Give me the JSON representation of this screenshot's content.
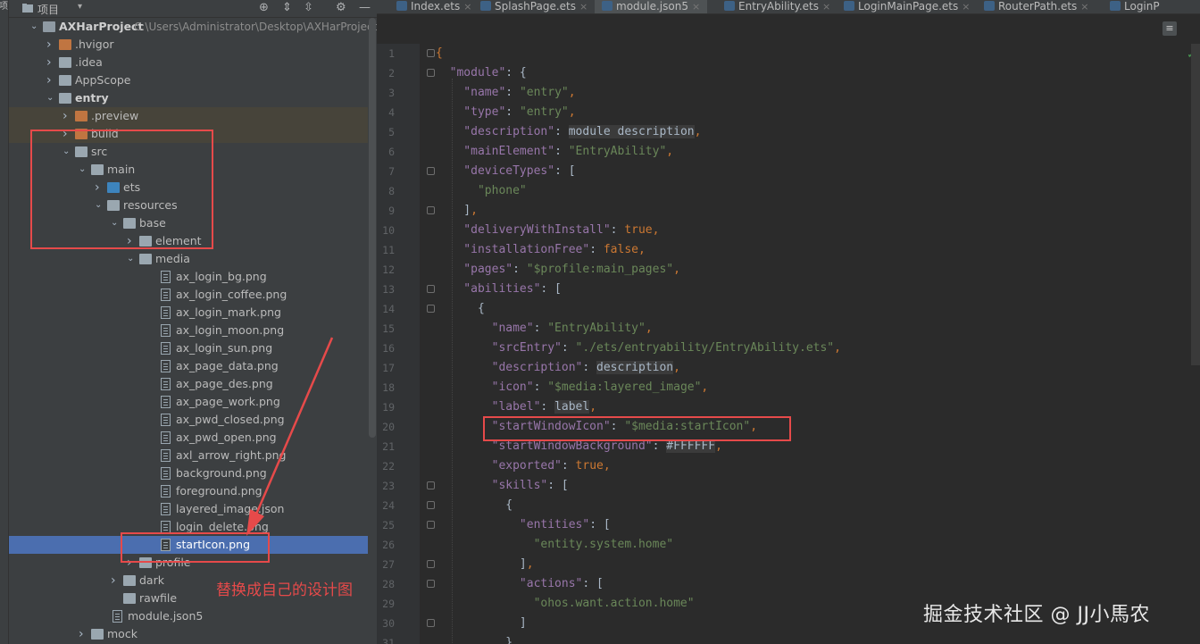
{
  "left_strip": {
    "label": "项"
  },
  "project_panel": {
    "title": "项目",
    "dropdown_glyph": "▾",
    "header_icons": [
      "crosshair-icon",
      "collapse-all-icon",
      "expand-all-icon",
      "settings-icon",
      "minimize-icon"
    ],
    "tree": [
      {
        "label": "AXHarProject",
        "path": "C:\\Users\\Administrator\\Desktop\\AXHarProject",
        "depth": 0,
        "kind": "root",
        "chevron": "open",
        "bold": true
      },
      {
        "label": ".hvigor",
        "depth": 1,
        "kind": "folder-orange",
        "chevron": "closed"
      },
      {
        "label": ".idea",
        "depth": 1,
        "kind": "folder-gray",
        "chevron": "closed"
      },
      {
        "label": "AppScope",
        "depth": 1,
        "kind": "folder-gray",
        "chevron": "closed"
      },
      {
        "label": "entry",
        "depth": 1,
        "kind": "folder-gray",
        "chevron": "open",
        "bold": true
      },
      {
        "label": ".preview",
        "depth": 2,
        "kind": "folder-orange",
        "chevron": "closed",
        "highlight": true
      },
      {
        "label": "build",
        "depth": 2,
        "kind": "folder-orange",
        "chevron": "closed",
        "highlight": true
      },
      {
        "label": "src",
        "depth": 2,
        "kind": "folder-gray",
        "chevron": "open"
      },
      {
        "label": "main",
        "depth": 3,
        "kind": "folder-gray",
        "chevron": "open"
      },
      {
        "label": "ets",
        "depth": 4,
        "kind": "folder-blue",
        "chevron": "closed"
      },
      {
        "label": "resources",
        "depth": 4,
        "kind": "folder-gray",
        "chevron": "open"
      },
      {
        "label": "base",
        "depth": 5,
        "kind": "folder-gray",
        "chevron": "open"
      },
      {
        "label": "element",
        "depth": 6,
        "kind": "folder-gray",
        "chevron": "closed"
      },
      {
        "label": "media",
        "depth": 6,
        "kind": "folder-gray",
        "chevron": "open"
      },
      {
        "label": "ax_login_bg.png",
        "depth": 7,
        "kind": "file"
      },
      {
        "label": "ax_login_coffee.png",
        "depth": 7,
        "kind": "file"
      },
      {
        "label": "ax_login_mark.png",
        "depth": 7,
        "kind": "file"
      },
      {
        "label": "ax_login_moon.png",
        "depth": 7,
        "kind": "file"
      },
      {
        "label": "ax_login_sun.png",
        "depth": 7,
        "kind": "file"
      },
      {
        "label": "ax_page_data.png",
        "depth": 7,
        "kind": "file"
      },
      {
        "label": "ax_page_des.png",
        "depth": 7,
        "kind": "file"
      },
      {
        "label": "ax_page_work.png",
        "depth": 7,
        "kind": "file"
      },
      {
        "label": "ax_pwd_closed.png",
        "depth": 7,
        "kind": "file"
      },
      {
        "label": "ax_pwd_open.png",
        "depth": 7,
        "kind": "file"
      },
      {
        "label": "axl_arrow_right.png",
        "depth": 7,
        "kind": "file"
      },
      {
        "label": "background.png",
        "depth": 7,
        "kind": "file"
      },
      {
        "label": "foreground.png",
        "depth": 7,
        "kind": "file"
      },
      {
        "label": "layered_image.json",
        "depth": 7,
        "kind": "file"
      },
      {
        "label": "login_delete.png",
        "depth": 7,
        "kind": "file"
      },
      {
        "label": "startIcon.png",
        "depth": 7,
        "kind": "file",
        "selected": true
      },
      {
        "label": "profile",
        "depth": 6,
        "kind": "folder-gray",
        "chevron": "closed"
      },
      {
        "label": "dark",
        "depth": 5,
        "kind": "folder-gray",
        "chevron": "closed"
      },
      {
        "label": "rawfile",
        "depth": 5,
        "kind": "folder-gray",
        "chevron": "none"
      },
      {
        "label": "module.json5",
        "depth": 4,
        "kind": "file"
      },
      {
        "label": "mock",
        "depth": 3,
        "kind": "folder-gray",
        "chevron": "closed"
      }
    ]
  },
  "editor": {
    "tabs": [
      {
        "label": "Index.ets",
        "active": false
      },
      {
        "label": "SplashPage.ets",
        "active": false
      },
      {
        "label": "module.json5",
        "active": true
      },
      {
        "label": "EntryAbility.ets",
        "active": false
      },
      {
        "label": "LoginMainPage.ets",
        "active": false
      },
      {
        "label": "RouterPath.ets",
        "active": false
      },
      {
        "label": "LoginP",
        "active": false
      }
    ],
    "tab_close_glyph": "×",
    "reader_icon": "≡",
    "status_check": "✓",
    "lines": [
      [
        [
          "b",
          "{"
        ]
      ],
      [
        [
          "k",
          "  \"module\""
        ],
        [
          "t",
          ": {"
        ]
      ],
      [
        [
          "k",
          "    \"name\""
        ],
        [
          "t",
          ": "
        ],
        [
          "s",
          "\"entry\""
        ],
        [
          "p",
          ","
        ]
      ],
      [
        [
          "k",
          "    \"type\""
        ],
        [
          "t",
          ": "
        ],
        [
          "s",
          "\"entry\""
        ],
        [
          "p",
          ","
        ]
      ],
      [
        [
          "k",
          "    \"description\""
        ],
        [
          "t",
          ": "
        ],
        [
          "pl",
          "module description"
        ],
        [
          "p",
          ","
        ]
      ],
      [
        [
          "k",
          "    \"mainElement\""
        ],
        [
          "t",
          ": "
        ],
        [
          "s",
          "\"EntryAbility\""
        ],
        [
          "p",
          ","
        ]
      ],
      [
        [
          "k",
          "    \"deviceTypes\""
        ],
        [
          "t",
          ": ["
        ]
      ],
      [
        [
          "s",
          "      \"phone\""
        ]
      ],
      [
        [
          "t",
          "    ]"
        ],
        [
          "p",
          ","
        ]
      ],
      [
        [
          "k",
          "    \"deliveryWithInstall\""
        ],
        [
          "t",
          ": "
        ],
        [
          "p",
          "true,"
        ]
      ],
      [
        [
          "k",
          "    \"installationFree\""
        ],
        [
          "t",
          ": "
        ],
        [
          "p",
          "false,"
        ]
      ],
      [
        [
          "k",
          "    \"pages\""
        ],
        [
          "t",
          ": "
        ],
        [
          "s",
          "\"$profile:main_pages\""
        ],
        [
          "p",
          ","
        ]
      ],
      [
        [
          "k",
          "    \"abilities\""
        ],
        [
          "t",
          ": ["
        ]
      ],
      [
        [
          "t",
          "      {"
        ]
      ],
      [
        [
          "k",
          "        \"name\""
        ],
        [
          "t",
          ": "
        ],
        [
          "s",
          "\"EntryAbility\""
        ],
        [
          "p",
          ","
        ]
      ],
      [
        [
          "k",
          "        \"srcEntry\""
        ],
        [
          "t",
          ": "
        ],
        [
          "s",
          "\"./ets/entryability/EntryAbility.ets\""
        ],
        [
          "p",
          ","
        ]
      ],
      [
        [
          "k",
          "        \"description\""
        ],
        [
          "t",
          ": "
        ],
        [
          "pl",
          "description"
        ],
        [
          "p",
          ","
        ]
      ],
      [
        [
          "k",
          "        \"icon\""
        ],
        [
          "t",
          ": "
        ],
        [
          "s",
          "\"$media:layered_image\""
        ],
        [
          "p",
          ","
        ]
      ],
      [
        [
          "k",
          "        \"label\""
        ],
        [
          "t",
          ": "
        ],
        [
          "pl",
          "label"
        ],
        [
          "p",
          ","
        ]
      ],
      [
        [
          "k",
          "        \"startWindowIcon\""
        ],
        [
          "t",
          ": "
        ],
        [
          "s",
          "\"$media:startIcon\""
        ],
        [
          "p",
          ","
        ]
      ],
      [
        [
          "k",
          "        \"startWindowBackground\""
        ],
        [
          "t",
          ": "
        ],
        [
          "pl",
          "#FFFFFF"
        ],
        [
          "p",
          ","
        ]
      ],
      [
        [
          "k",
          "        \"exported\""
        ],
        [
          "t",
          ": "
        ],
        [
          "p",
          "true,"
        ]
      ],
      [
        [
          "k",
          "        \"skills\""
        ],
        [
          "t",
          ": ["
        ]
      ],
      [
        [
          "t",
          "          {"
        ]
      ],
      [
        [
          "k",
          "            \"entities\""
        ],
        [
          "t",
          ": ["
        ]
      ],
      [
        [
          "s",
          "              \"entity.system.home\""
        ]
      ],
      [
        [
          "t",
          "            ]"
        ],
        [
          "p",
          ","
        ]
      ],
      [
        [
          "k",
          "            \"actions\""
        ],
        [
          "t",
          ": ["
        ]
      ],
      [
        [
          "s",
          "              \"ohos.want.action.home\""
        ]
      ],
      [
        [
          "t",
          "            ]"
        ]
      ],
      [
        [
          "t",
          "          }"
        ]
      ]
    ],
    "line_numbers": [
      "1",
      "2",
      "3",
      "4",
      "5",
      "6",
      "7",
      "8",
      "9",
      "10",
      "11",
      "12",
      "13",
      "14",
      "15",
      "16",
      "17",
      "18",
      "19",
      "20",
      "21",
      "22",
      "23",
      "24",
      "25",
      "26",
      "27",
      "28",
      "29",
      "30",
      "31"
    ]
  },
  "annotation": {
    "text": "替换成自己的设计图",
    "color": "#e64a4a"
  },
  "watermark": "掘金技术社区 @ JJ小馬农"
}
